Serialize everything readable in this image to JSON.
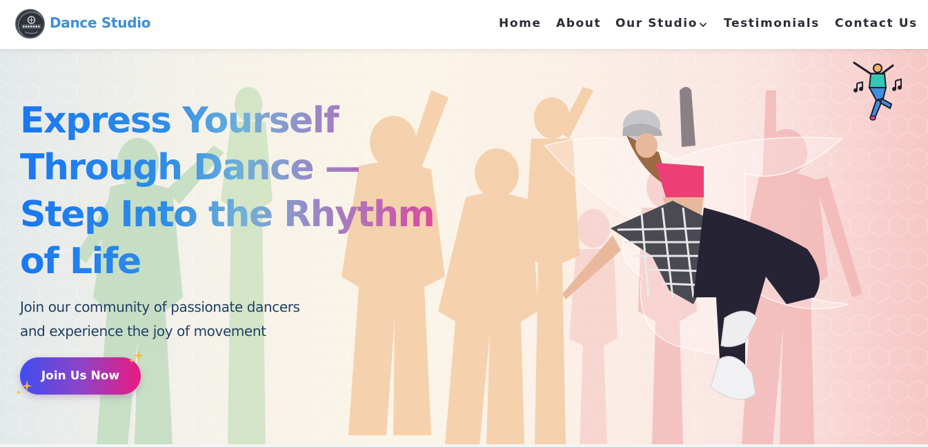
{
  "brand": {
    "name": "Dance Studio",
    "logo_text": "KALAKAAR",
    "color": "#3d8fd8"
  },
  "nav": {
    "items": [
      {
        "label": "Home",
        "has_dropdown": false
      },
      {
        "label": "About",
        "has_dropdown": false
      },
      {
        "label": "Our Studio",
        "has_dropdown": true
      },
      {
        "label": "Testimonials",
        "has_dropdown": false
      },
      {
        "label": "Contact Us",
        "has_dropdown": false
      }
    ],
    "chevron_icon": "chevron-down-icon"
  },
  "hero": {
    "headline": {
      "line1": "Express Yourself",
      "line2": "Through Dance —",
      "line3": "Step Into the Rhythm",
      "line4": "of Life"
    },
    "subtitle": {
      "line1": "Join our community of passionate dancers",
      "line2": "and experience the joy of movement"
    },
    "cta_label": "Join Us Now",
    "gradient_colors": [
      "#1877f2",
      "#6fb0d8",
      "#a77bbf",
      "#e0449a"
    ],
    "cta_colors": [
      "#3f4df0",
      "#8d44c8",
      "#ea1a7f"
    ],
    "icons": [
      "sparkle-icon",
      "dancer-music-icon",
      "dancer-photo"
    ]
  }
}
